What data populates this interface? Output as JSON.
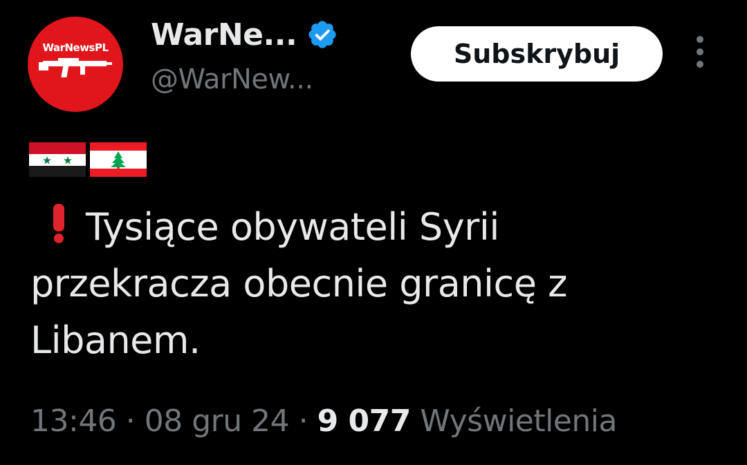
{
  "author": {
    "avatar_text": "WarNewsPL",
    "display_name": "WarNe...",
    "handle": "@WarNew...",
    "verified": true
  },
  "actions": {
    "subscribe_label": "Subskrybuj",
    "more_icon": "more-vertical-icon"
  },
  "tweet": {
    "flags": [
      "syria-flag-icon",
      "lebanon-flag-icon"
    ],
    "emoji": "red-exclamation-icon",
    "line1": "Tysiące obywateli Syrii",
    "line2": "przekracza obecnie granicę z",
    "line3": "Libanem."
  },
  "meta": {
    "time": "13:46",
    "sep1": " · ",
    "date": "08 gru 24",
    "sep2": " · ",
    "views_count": "9 077",
    "views_label": "Wyświetlenia"
  },
  "colors": {
    "background": "#000000",
    "text_primary": "#e7e9ea",
    "text_secondary": "#71767b",
    "verified_blue": "#1d9bf0",
    "avatar_red": "#e0161c"
  }
}
